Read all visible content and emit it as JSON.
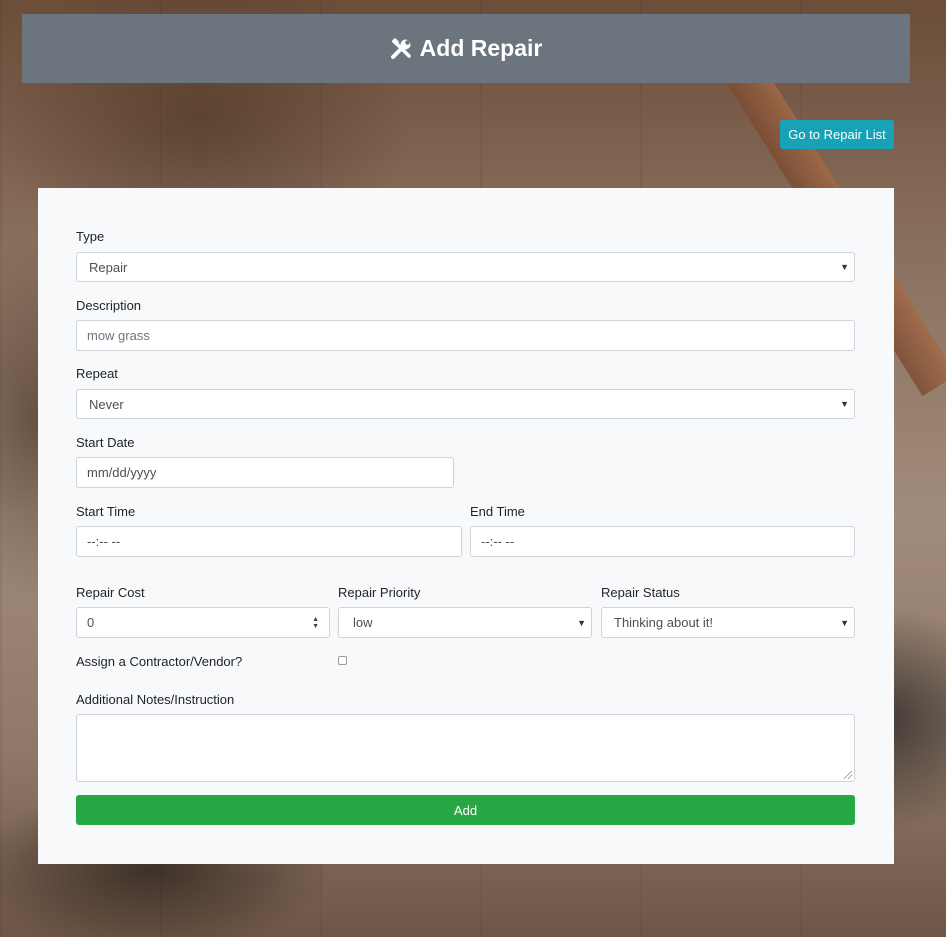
{
  "header": {
    "title": "Add Repair",
    "icon": "tools-icon"
  },
  "nav": {
    "repair_list_label": "Go to Repair List"
  },
  "form": {
    "type_label": "Type",
    "type_value": "Repair",
    "description_label": "Description",
    "description_placeholder": "mow grass",
    "repeat_label": "Repeat",
    "repeat_value": "Never",
    "start_date_label": "Start Date",
    "start_date_placeholder": "mm/dd/yyyy",
    "start_time_label": "Start Time",
    "start_time_placeholder": "--:-- --",
    "end_time_label": "End Time",
    "end_time_placeholder": "--:-- --",
    "repair_cost_label": "Repair Cost",
    "repair_cost_value": "0",
    "repair_priority_label": "Repair Priority",
    "repair_priority_value": "low",
    "repair_status_label": "Repair Status",
    "repair_status_value": "Thinking about it!",
    "contractor_label": "Assign a Contractor/Vendor?",
    "notes_label": "Additional Notes/Instruction",
    "submit_label": "Add"
  },
  "colors": {
    "header_bg": "#6c757d",
    "info_button": "#17a2b8",
    "success_button": "#28a745",
    "card_bg": "#f8f9fa"
  }
}
